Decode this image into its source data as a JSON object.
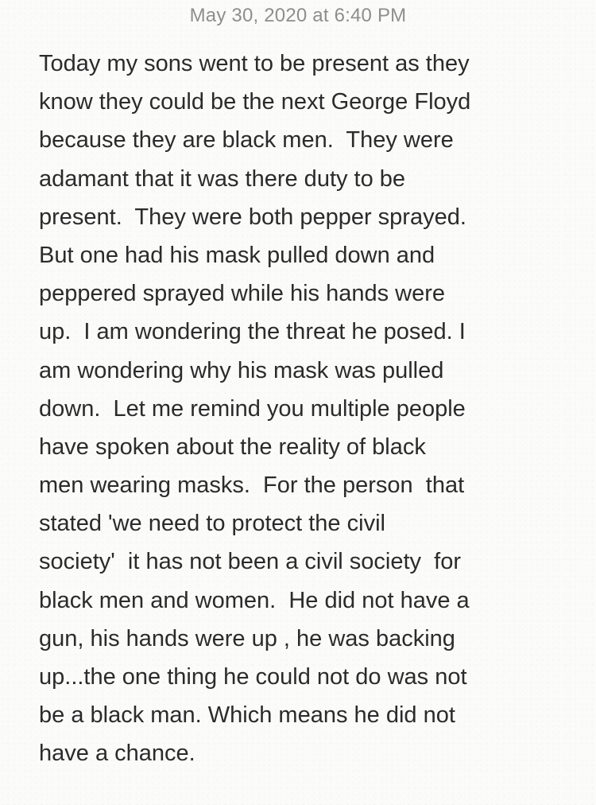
{
  "note": {
    "timestamp": "May 30, 2020 at 6:40 PM",
    "lines": [
      "Today my sons went to be present as they",
      "know they could be the next George Floyd",
      "because they are black men.  They were",
      "adamant that it was there duty to be",
      "present.  They were both pepper sprayed.",
      "But one had his mask pulled down and",
      "peppered sprayed while his hands were",
      "up.  I am wondering the threat he posed. I",
      "am wondering why his mask was pulled",
      "down.  Let me remind you multiple people",
      "have spoken about the reality of black",
      "men wearing masks.  For the person  that",
      "stated 'we need to protect the civil",
      "society'  it has not been a civil society  for",
      "black men and women.  He did not have a",
      "gun, his hands were up , he was backing",
      "up...the one thing he could not do was not",
      "be a black man. Which means he did not",
      "have a chance."
    ]
  }
}
